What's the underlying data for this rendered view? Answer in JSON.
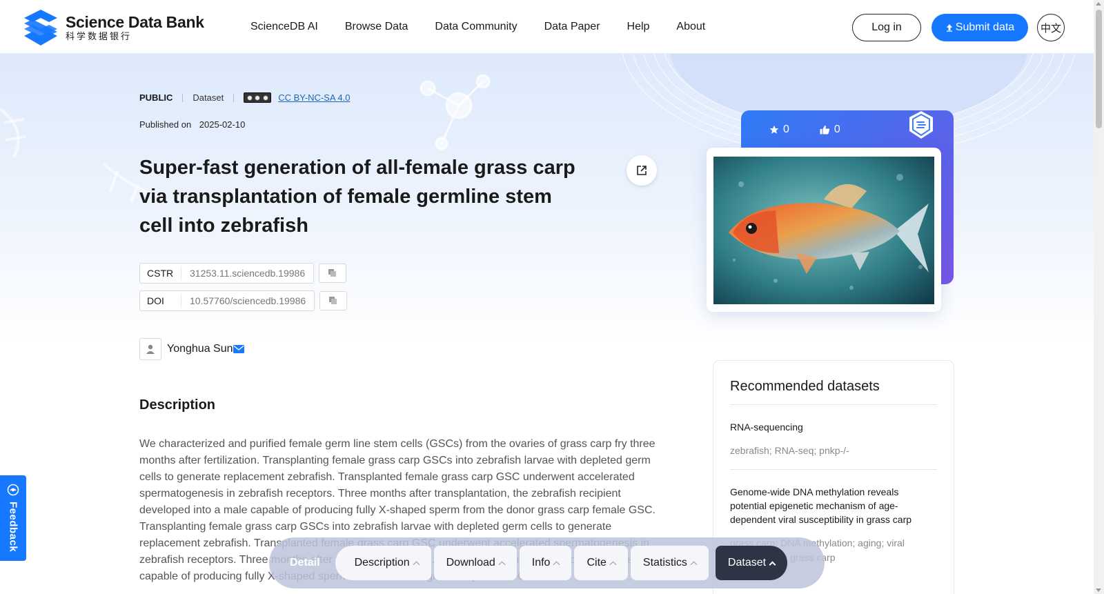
{
  "header": {
    "logo_en": "Science Data Bank",
    "logo_cn": "科学数据银行",
    "nav": [
      "ScienceDB AI",
      "Browse Data",
      "Data Community",
      "Data Paper",
      "Help",
      "About"
    ],
    "login": "Log in",
    "submit": "Submit data",
    "lang": "中文"
  },
  "dataset": {
    "access": "PUBLIC",
    "type": "Dataset",
    "license": "CC BY-NC-SA 4.0",
    "published_label": "Published on",
    "published_date": "2025-02-10",
    "title": "Super-fast generation of all-female grass carp via transplantation of female germline stem cell into zebrafish",
    "cstr_label": "CSTR",
    "cstr": "31253.11.sciencedb.19986",
    "doi_label": "DOI",
    "doi": "10.57760/sciencedb.19986",
    "author": "Yonghua Sun",
    "stars": "0",
    "likes": "0"
  },
  "description": {
    "heading": "Description",
    "text": "We characterized and purified female germ line stem cells (GSCs) from the ovaries of grass carp fry three months after fertilization. Transplanting female grass carp GSCs into zebrafish larvae with depleted germ cells to generate replacement zebrafish. Transplanted female grass carp GSC underwent accelerated spermatogenesis in zebrafish receptors. Three months after transplantation, the zebrafish recipient developed into a male capable of producing fully X-shaped sperm from the donor grass carp female GSC. Transplanting female grass carp GSCs into zebrafish larvae with depleted germ cells to generate replacement zebrafish. Transplanted female grass carp GSC underwent accelerated spermatogenesis in zebrafish receptors. Three months after transplantation, the zebrafish recipient developed into a male capable of producing fully X-shaped sperm from the donor grass carp female GSC."
  },
  "recommended": {
    "title": "Recommended datasets",
    "items": [
      {
        "title": "RNA-sequencing",
        "keywords": "zebrafish; RNA-seq; pnkp-/-"
      },
      {
        "title": "Genome-wide DNA methylation reveals potential epigenetic mechanism of age-dependent viral susceptibility in grass carp",
        "keywords": "grass carp; DNA methylation; aging; viral susceptibility; grass carp"
      }
    ]
  },
  "feedback": "Feedback",
  "bottom_bar": {
    "detail": "Detail",
    "items": [
      "Description",
      "Download",
      "Info",
      "Cite",
      "Statistics"
    ],
    "active": "Dataset"
  },
  "colors": {
    "brand": "#1677ff",
    "card_gradient_start": "#2f7bf6",
    "card_gradient_end": "#7a57e8",
    "bottom_active": "#2f3445"
  }
}
